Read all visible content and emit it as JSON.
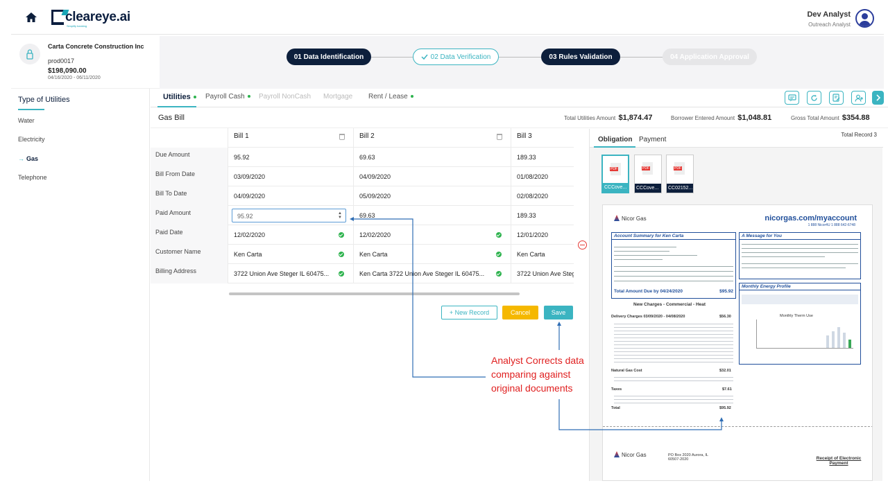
{
  "header": {
    "brand": "cleareye.ai",
    "brand_tagline": "Simplify banking",
    "user_name": "Dev Analyst",
    "user_role": "Outreach Analyst"
  },
  "company": {
    "name": "Carta Concrete Construction Inc",
    "id": "prod0017",
    "amount": "$198,090.00",
    "dates": "04/16/2020 - 06/11/2020"
  },
  "steps": [
    {
      "label": "01 Data Identification",
      "state": "complete"
    },
    {
      "label": "02 Data Verification",
      "state": "done-check"
    },
    {
      "label": "03 Rules Validation",
      "state": "active"
    },
    {
      "label": "04 Application Approval",
      "state": "disabled"
    }
  ],
  "sidebar": {
    "title": "Type of Utilities",
    "items": [
      {
        "label": "Water"
      },
      {
        "label": "Electricity"
      },
      {
        "label": "Gas",
        "active": true
      },
      {
        "label": "Telephone"
      }
    ]
  },
  "tabs": [
    {
      "label": "Utilities",
      "dot": true
    },
    {
      "label": "Payroll Cash",
      "dot": true
    },
    {
      "label": "Payroll NonCash",
      "dot": false
    },
    {
      "label": "Mortgage",
      "dot": false
    },
    {
      "label": "Rent / Lease",
      "dot": true
    }
  ],
  "section": {
    "title": "Gas Bill",
    "totals": [
      {
        "label": "Total Utilities Amount",
        "value": "$1,874.47"
      },
      {
        "label": "Borrower Entered Amount",
        "value": "$1,048.81"
      },
      {
        "label": "Gross Total Amount",
        "value": "$354.88"
      }
    ]
  },
  "bills": {
    "columns": [
      "Bill 1",
      "Bill 2",
      "Bill 3"
    ],
    "row_labels": [
      "Due Amount",
      "Bill From Date",
      "Bill To Date",
      "Paid Amount",
      "Paid Date",
      "Customer Name",
      "Billing Address"
    ],
    "rows": [
      [
        "95.92",
        "69.63",
        "189.33"
      ],
      [
        "03/09/2020",
        "04/09/2020",
        "01/08/2020"
      ],
      [
        "04/09/2020",
        "05/09/2020",
        "02/08/2020"
      ],
      [
        "95.92",
        "69.63",
        "189.33"
      ],
      [
        "12/02/2020",
        "12/02/2020",
        "12/01/2020"
      ],
      [
        "Ken Carta",
        "Ken Carta",
        "Ken Carta"
      ],
      [
        "3722 Union Ave Steger IL 60475...",
        "Ken Carta 3722 Union Ave Steger IL 60475...",
        "3722 Union Ave Steg"
      ]
    ]
  },
  "actions": {
    "new_record": "+ New Record",
    "cancel": "Cancel",
    "save": "Save"
  },
  "doc_panel": {
    "tabs": [
      "Obligation",
      "Payment"
    ],
    "total_record": "Total Record 3",
    "thumbnails": [
      "CCCove...",
      "CCCove...",
      "CC02152..."
    ],
    "bill": {
      "logo": "Nicor Gas",
      "url": "nicorgas.com/myaccount",
      "phone": "1 888 Nicor4U   1 888 642-6748",
      "summary_title": "Account Summary for Ken Carta",
      "message_title": "A Message for You",
      "amount_due_label": "Total Amount Due by 04/24/2020",
      "amount_due": "$95.92",
      "new_charges_title": "New Charges - Commercial - Heat",
      "delivery_label": "Delivery Charges 03/09/2020 - 04/08/2020",
      "delivery_value": "$56.30",
      "natural_gas_label": "Natural Gas Cost",
      "natural_gas_value": "$32.01",
      "taxes_label": "Taxes",
      "taxes_value": "$7.61",
      "total_label": "Total",
      "total_value": "$95.92",
      "energy_title": "Monthly Energy Profile",
      "therm_use": "Monthly Therm Use",
      "receipt": "Receipt of Electronic Payment",
      "po_box": "PO Box 2020 Aurora, IL 60507-2020"
    }
  },
  "annotation": {
    "lines": [
      "Analyst Corrects data",
      "comparing against",
      "original documents"
    ],
    "color": "#e02020"
  }
}
